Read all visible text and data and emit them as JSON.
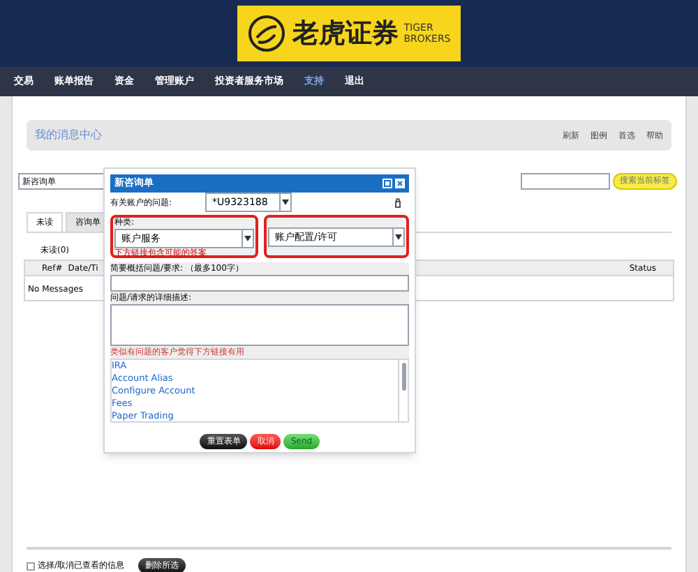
{
  "logo": {
    "chinese": "老虎证券",
    "english_top": "TIGER",
    "english_bottom": "BROKERS"
  },
  "nav": [
    {
      "label": "交易",
      "selected": false
    },
    {
      "label": "账单报告",
      "selected": false
    },
    {
      "label": "资金",
      "selected": false
    },
    {
      "label": "管理账户",
      "selected": false
    },
    {
      "label": "投资者服务市场",
      "selected": false
    },
    {
      "label": "支持",
      "selected": true
    },
    {
      "label": "退出",
      "selected": false
    }
  ],
  "panel": {
    "title": "我的消息中心",
    "links": [
      "刷新",
      "图例",
      "首选",
      "帮助"
    ]
  },
  "ticket_select": {
    "value": "新咨询单"
  },
  "search": {
    "button": "搜索当前标签"
  },
  "tabs": [
    {
      "label": "未读",
      "selected": true
    },
    {
      "label": "咨询单",
      "selected": false
    }
  ],
  "unread_count": "未读(0)",
  "table": {
    "columns": [
      "Ref#",
      "Date/Ti",
      "Status"
    ],
    "empty": "No Messages"
  },
  "dialog": {
    "title": "新咨询单",
    "account_label": "有关账户的问题:",
    "account_value": "*U9323188",
    "category_label": "种类:",
    "category_value": "账户服务",
    "subcategory_value": "账户配置/许可",
    "hint": "下方链接包含可能的答案",
    "summary_label": "简要概括问题/要求: （最多100字）",
    "detail_label": "问题/请求的详细描述:",
    "links_label": "类似有问题的客户觉得下方链接有用",
    "links": [
      "IRA",
      "Account Alias",
      "Configure Account",
      "Fees",
      "Paper Trading"
    ],
    "buttons": [
      {
        "label": "重置表单",
        "kind": "dark"
      },
      {
        "label": "取消",
        "kind": "red"
      },
      {
        "label": "Send",
        "kind": "green"
      }
    ]
  },
  "footer": {
    "checkbox_label": "选择/取消已查看的信息",
    "checked": false,
    "button": "删除所选"
  }
}
